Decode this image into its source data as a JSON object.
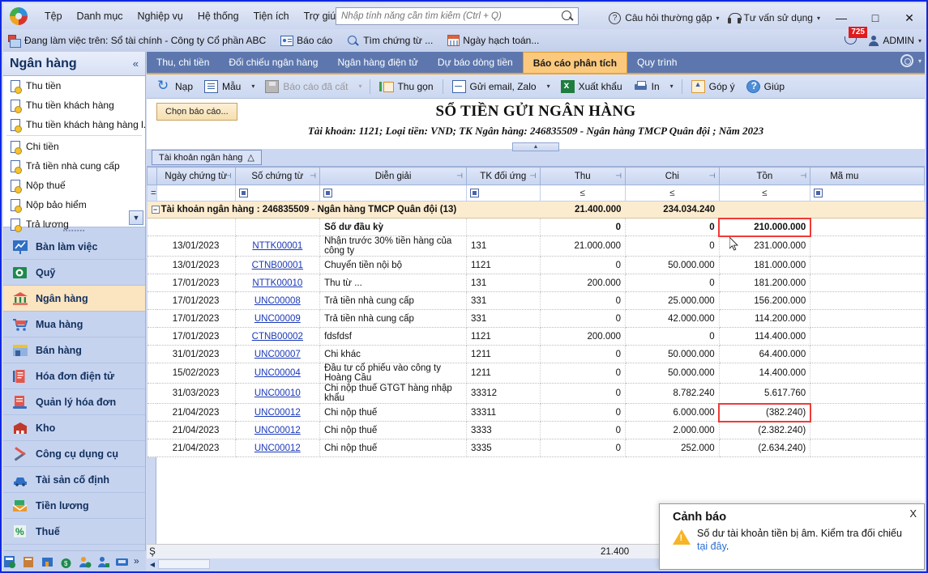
{
  "window": {
    "minimize": "—",
    "maximize": "□",
    "close": "✕"
  },
  "menubar": {
    "logo": "app-logo",
    "items": [
      "Tệp",
      "Danh mục",
      "Nghiệp vụ",
      "Hệ thống",
      "Tiện ích",
      "Trợ giúp"
    ],
    "search_placeholder": "Nhập tính năng cần tìm kiếm (Ctrl + Q)",
    "search_value": "",
    "faq_label": "Câu hỏi thường gặp",
    "support_label": "Tư vấn sử dụng",
    "caret": "▾"
  },
  "subbar": {
    "working_on": "Đang làm việc trên: Sổ tài chính - Công ty Cổ phần ABC",
    "report_label": "Báo cáo",
    "find_doc_label": "Tìm chứng từ ...",
    "posting_date_label": "Ngày hạch toán...",
    "notification_count": "725",
    "user_label": "ADMIN",
    "user_caret": "▾"
  },
  "sidebar": {
    "title": "Ngân hàng",
    "collapse": "«",
    "sublist": [
      {
        "label": "Thu tiền"
      },
      {
        "label": "Thu tiền khách hàng"
      },
      {
        "label": "Thu tiền khách hàng hàng l..."
      },
      {
        "label": "Chi tiền"
      },
      {
        "label": "Trả tiền nhà cung cấp"
      },
      {
        "label": "Nộp thuế"
      },
      {
        "label": "Nộp bảo hiểm"
      },
      {
        "label": "Trả lương"
      }
    ],
    "sublist_scroll_caret": "▼",
    "nav": [
      {
        "label": "Bàn làm việc",
        "icon": "chart-board-icon",
        "active": false
      },
      {
        "label": "Quỹ",
        "icon": "safe-icon",
        "active": false
      },
      {
        "label": "Ngân hàng",
        "icon": "bank-icon",
        "active": true
      },
      {
        "label": "Mua hàng",
        "icon": "cart-icon",
        "active": false
      },
      {
        "label": "Bán hàng",
        "icon": "shop-icon",
        "active": false
      },
      {
        "label": "Hóa đơn điện tử",
        "icon": "e-invoice-icon",
        "active": false
      },
      {
        "label": "Quản lý hóa đơn",
        "icon": "invoice-manage-icon",
        "active": false
      },
      {
        "label": "Kho",
        "icon": "warehouse-icon",
        "active": false
      },
      {
        "label": "Công cụ dụng cụ",
        "icon": "tools-icon",
        "active": false
      },
      {
        "label": "Tài sản cố định",
        "icon": "car-icon",
        "active": false
      },
      {
        "label": "Tiền lương",
        "icon": "salary-icon",
        "active": false
      },
      {
        "label": "Thuế",
        "icon": "tax-percent-icon",
        "active": false
      }
    ],
    "tray_more": "»"
  },
  "tabs": {
    "items": [
      {
        "label": "Thu, chi tiền",
        "active": false
      },
      {
        "label": "Đối chiếu ngân hàng",
        "active": false
      },
      {
        "label": "Ngân hàng điện tử",
        "active": false
      },
      {
        "label": "Dự báo dòng tiền",
        "active": false
      },
      {
        "label": "Báo cáo phân tích",
        "active": true
      },
      {
        "label": "Quy trình",
        "active": false
      }
    ],
    "settings_caret": "▾"
  },
  "toolbar": {
    "buttons": [
      {
        "label": "Nạp",
        "icon": "refresh-icon",
        "caret": false,
        "disabled": false
      },
      {
        "label": "Mẫu",
        "icon": "template-icon",
        "caret": true,
        "disabled": false
      },
      {
        "label": "Báo cáo đã cất",
        "icon": "save-icon",
        "caret": true,
        "disabled": true
      },
      {
        "label": "Thu gọn",
        "icon": "collapse-icon",
        "caret": false,
        "disabled": false
      },
      {
        "label": "Gửi email, Zalo",
        "icon": "mail-icon",
        "caret": true,
        "disabled": false
      },
      {
        "label": "Xuất khẩu",
        "icon": "excel-icon",
        "caret": false,
        "disabled": false
      },
      {
        "label": "In",
        "icon": "print-icon",
        "caret": true,
        "disabled": false
      },
      {
        "label": "Góp ý",
        "icon": "feedback-icon",
        "caret": false,
        "disabled": false
      },
      {
        "label": "Giúp",
        "icon": "help-icon",
        "caret": false,
        "disabled": false
      }
    ],
    "caret": "▾"
  },
  "report": {
    "choose_report_label": "Chọn báo cáo...",
    "title": "SỔ TIỀN GỬI NGÂN HÀNG",
    "subtitle": "Tài khoản: 1121; Loại tiền: VND; TK Ngân hàng: 246835509 - Ngân hàng TMCP Quân đội ; Năm 2023",
    "collapse_caret": "▲",
    "group_chip": "Tài khoản ngân hàng",
    "group_chip_sort": "△"
  },
  "grid": {
    "columns": [
      {
        "label": "Ngày chứng từ",
        "pin": "⊣"
      },
      {
        "label": "Số chứng từ",
        "pin": "⊣"
      },
      {
        "label": "Diễn giải",
        "pin": "⊣"
      },
      {
        "label": "TK đối ứng",
        "pin": "⊣"
      },
      {
        "label": "Thu",
        "pin": "⊣"
      },
      {
        "label": "Chi",
        "pin": "⊣"
      },
      {
        "label": "Tồn",
        "pin": "⊣"
      },
      {
        "label": "Mã mu",
        "pin": ""
      }
    ],
    "filter_row": {
      "date": "",
      "doc_no": "filter-box",
      "desc": "filter-box",
      "account": "filter-box",
      "thu": "≤",
      "chi": "≤",
      "ton": "≤",
      "ma": "filter-box",
      "equals": "="
    },
    "group_row": {
      "expander": "−",
      "label": "Tài khoản ngân hàng : 246835509 - Ngân hàng TMCP Quân đội  (13)",
      "thu": "21.400.000",
      "chi": "234.034.240",
      "ton": ""
    },
    "rows": [
      {
        "date": "",
        "doc": "",
        "desc": "Số dư đầu kỳ",
        "acct": "",
        "thu": "0",
        "chi": "0",
        "ton": "210.000.000",
        "bold": true,
        "link": false,
        "neg": false,
        "highlight_ton": true
      },
      {
        "date": "13/01/2023",
        "doc": "NTTK00001",
        "desc": "Nhận trước 30% tiền hàng của công ty",
        "acct": "131",
        "thu": "21.000.000",
        "chi": "0",
        "ton": "231.000.000",
        "bold": false,
        "link": true,
        "neg": false,
        "highlight_ton": false
      },
      {
        "date": "13/01/2023",
        "doc": "CTNB00001",
        "desc": "Chuyển tiền nội bộ",
        "acct": "1121",
        "thu": "0",
        "chi": "50.000.000",
        "ton": "181.000.000",
        "bold": false,
        "link": true,
        "neg": false,
        "highlight_ton": false
      },
      {
        "date": "17/01/2023",
        "doc": "NTTK00010",
        "desc": "Thu từ ...",
        "acct": "131",
        "thu": "200.000",
        "chi": "0",
        "ton": "181.200.000",
        "bold": false,
        "link": true,
        "neg": false,
        "highlight_ton": false
      },
      {
        "date": "17/01/2023",
        "doc": "UNC00008",
        "desc": "Trả tiền nhà cung cấp",
        "acct": "331",
        "thu": "0",
        "chi": "25.000.000",
        "ton": "156.200.000",
        "bold": false,
        "link": true,
        "neg": false,
        "highlight_ton": false
      },
      {
        "date": "17/01/2023",
        "doc": "UNC00009",
        "desc": "Trả tiền nhà cung cấp",
        "acct": "331",
        "thu": "0",
        "chi": "42.000.000",
        "ton": "114.200.000",
        "bold": false,
        "link": true,
        "neg": false,
        "highlight_ton": false
      },
      {
        "date": "17/01/2023",
        "doc": "CTNB00002",
        "desc": "fdsfdsf",
        "acct": "1121",
        "thu": "200.000",
        "chi": "0",
        "ton": "114.400.000",
        "bold": false,
        "link": true,
        "neg": false,
        "highlight_ton": false
      },
      {
        "date": "31/01/2023",
        "doc": "UNC00007",
        "desc": "Chi khác",
        "acct": "1211",
        "thu": "0",
        "chi": "50.000.000",
        "ton": "64.400.000",
        "bold": false,
        "link": true,
        "neg": false,
        "highlight_ton": false
      },
      {
        "date": "15/02/2023",
        "doc": "UNC00004",
        "desc": "Đầu tư cổ phiếu vào công ty Hoàng Cầu",
        "acct": "1211",
        "thu": "0",
        "chi": "50.000.000",
        "ton": "14.400.000",
        "bold": false,
        "link": true,
        "neg": false,
        "highlight_ton": false
      },
      {
        "date": "31/03/2023",
        "doc": "UNC00010",
        "desc": "Chi nộp thuế GTGT hàng nhập khẩu",
        "acct": "33312",
        "thu": "0",
        "chi": "8.782.240",
        "ton": "5.617.760",
        "bold": false,
        "link": true,
        "neg": false,
        "highlight_ton": false
      },
      {
        "date": "21/04/2023",
        "doc": "UNC00012",
        "desc": "Chi nộp thuế",
        "acct": "33311",
        "thu": "0",
        "chi": "6.000.000",
        "ton": "(382.240)",
        "bold": false,
        "link": true,
        "neg": true,
        "highlight_ton": true
      },
      {
        "date": "21/04/2023",
        "doc": "UNC00012",
        "desc": "Chi nộp thuế",
        "acct": "3333",
        "thu": "0",
        "chi": "2.000.000",
        "ton": "(2.382.240)",
        "bold": false,
        "link": true,
        "neg": true,
        "highlight_ton": false
      },
      {
        "date": "21/04/2023",
        "doc": "UNC00012",
        "desc": "Chi nộp thuế",
        "acct": "3335",
        "thu": "0",
        "chi": "252.000",
        "ton": "(2.634.240)",
        "bold": false,
        "link": true,
        "neg": true,
        "highlight_ton": false
      }
    ],
    "footer": {
      "left": "Ş",
      "thu_total": "21.400"
    }
  },
  "toast": {
    "title": "Cảnh báo",
    "close": "X",
    "message_part1": "Số dư tài khoản tiền bị âm. Kiểm tra đối chiếu ",
    "message_link": "tại đây",
    "message_part2": "."
  },
  "colors": {
    "accent_orange": "#e8a33d",
    "tab_active": "#fbc97d",
    "tab_bar": "#5d77ae",
    "highlight_red": "#ef3b37",
    "negative_red": "#e01b1b",
    "link_blue": "#1a38b8",
    "window_border": "#1028e0",
    "group_row": "#fbecd0",
    "sidebar_active": "#fbe4c0"
  }
}
